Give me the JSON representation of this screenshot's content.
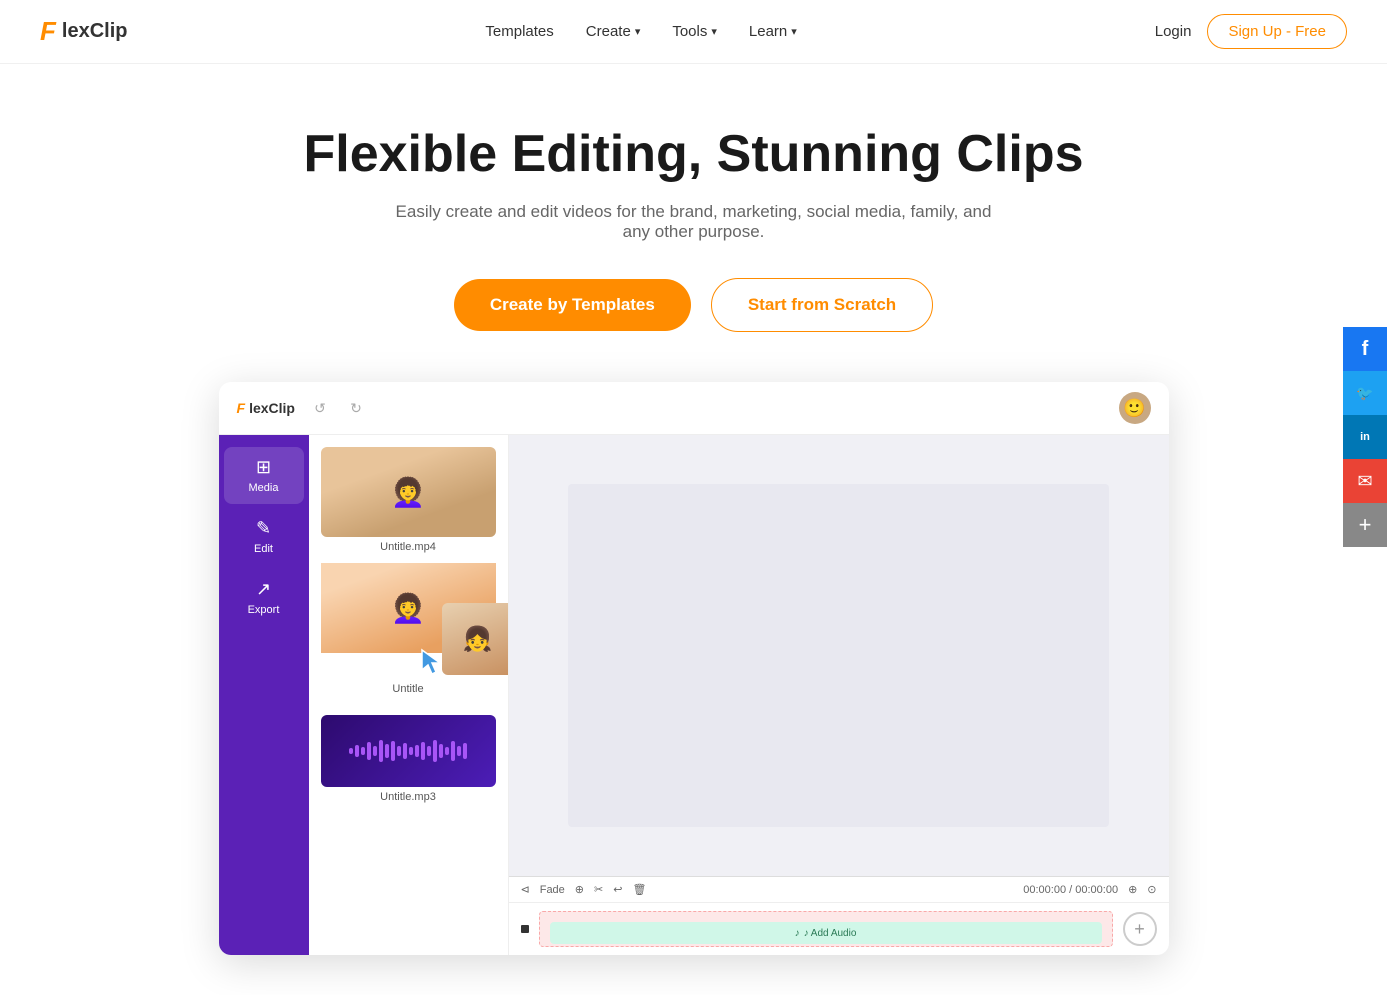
{
  "brand": {
    "name": "FlexClip",
    "f_char": "F",
    "flex": "lex",
    "clip": "Clip"
  },
  "nav": {
    "templates_label": "Templates",
    "create_label": "Create",
    "tools_label": "Tools",
    "learn_label": "Learn",
    "login_label": "Login",
    "signup_label": "Sign Up - Free"
  },
  "hero": {
    "headline": "Flexible Editing, Stunning Clips",
    "subheadline": "Easily create and edit videos for the brand, marketing, social media, family, and any other purpose.",
    "btn_template": "Create by Templates",
    "btn_scratch": "Start from Scratch"
  },
  "editor": {
    "topbar": {
      "undo_label": "↺",
      "redo_label": "↻"
    },
    "sidebar": {
      "items": [
        {
          "label": "Media",
          "icon": "⊞"
        },
        {
          "label": "Edit",
          "icon": "✎"
        },
        {
          "label": "Export",
          "icon": "↗"
        }
      ]
    },
    "media_panel": {
      "items": [
        {
          "name": "Untitle.mp4",
          "type": "video"
        },
        {
          "name": "Untitle",
          "type": "video2"
        },
        {
          "name": "Untitle.mp3",
          "type": "audio"
        }
      ]
    },
    "timeline": {
      "fade_label": "Fade",
      "time_display": "00:00:00 / 00:00:00",
      "add_audio_label": "♪ Add Audio"
    }
  },
  "social": {
    "facebook": "f",
    "twitter": "t",
    "linkedin": "in",
    "email": "✉",
    "more": "+"
  },
  "waveform": {
    "bars": [
      6,
      12,
      8,
      18,
      10,
      22,
      14,
      20,
      10,
      16,
      8,
      12,
      18,
      10,
      22,
      14,
      8,
      20,
      10,
      16
    ]
  }
}
